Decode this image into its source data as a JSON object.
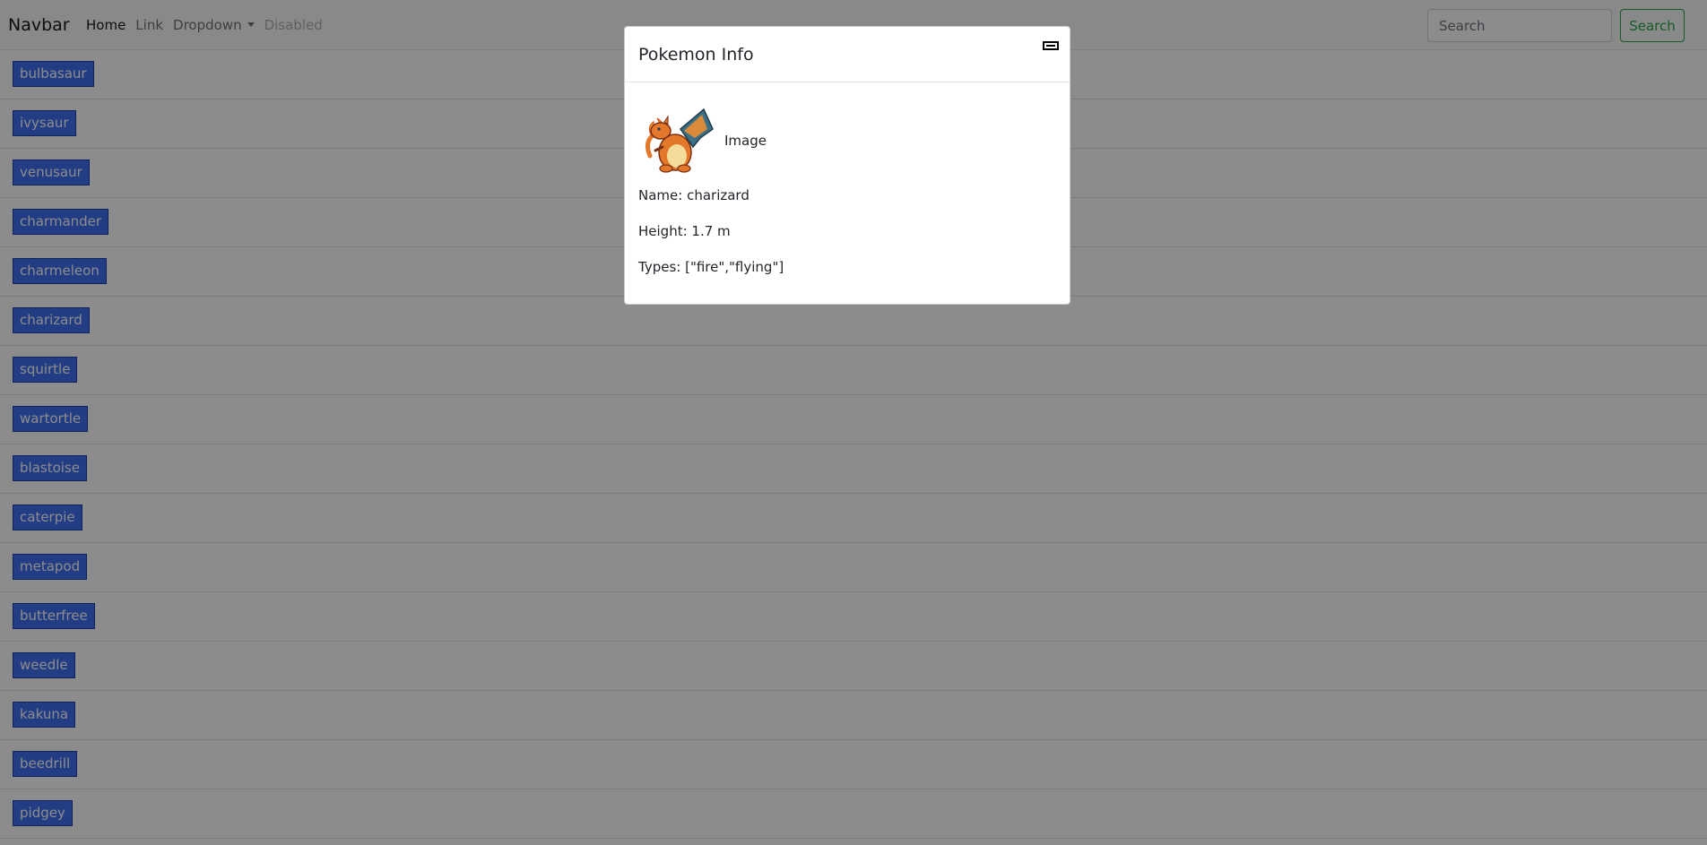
{
  "navbar": {
    "brand": "Navbar",
    "links": {
      "home": "Home",
      "link": "Link",
      "dropdown": "Dropdown",
      "disabled": "Disabled"
    },
    "search_placeholder": "Search",
    "search_button": "Search"
  },
  "pokemon_list": [
    "bulbasaur",
    "ivysaur",
    "venusaur",
    "charmander",
    "charmeleon",
    "charizard",
    "squirtle",
    "wartortle",
    "blastoise",
    "caterpie",
    "metapod",
    "butterfree",
    "weedle",
    "kakuna",
    "beedrill",
    "pidgey"
  ],
  "modal": {
    "title": "Pokemon Info",
    "image_label": "Image",
    "name_line": "Name: charizard",
    "height_line": "Height: 1.7 m",
    "types_line": "Types: [\"fire\",\"flying\"]"
  },
  "colors": {
    "pokemon_button_bg": "#3f6ff0",
    "search_button_accent": "#28a745",
    "backdrop": "rgba(0,0,0,0.45)"
  },
  "icons": {
    "close": "close-icon",
    "dropdown": "caret-down-icon"
  }
}
